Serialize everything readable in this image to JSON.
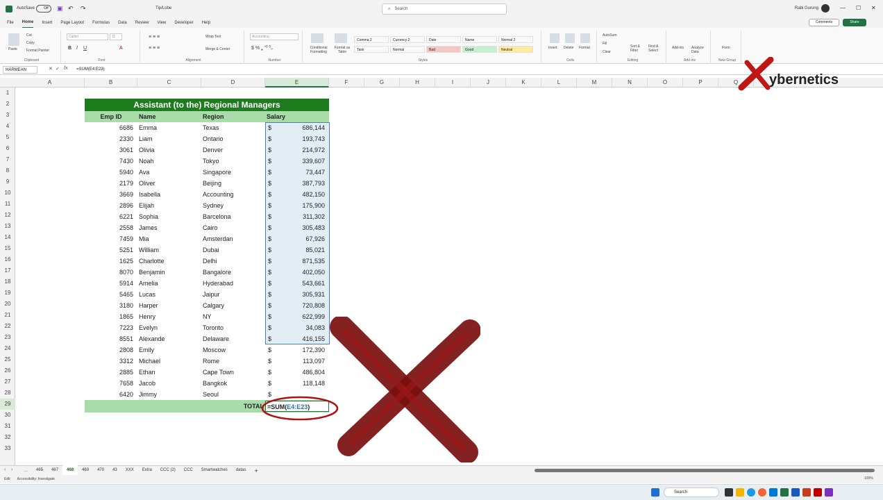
{
  "titlebar": {
    "autosave": "AutoSave",
    "toggle": "Off",
    "filename": "Tip/Lobe",
    "search": "Search",
    "user": "Rabi Gurung"
  },
  "menu": [
    "File",
    "Home",
    "Insert",
    "Page Layout",
    "Formulas",
    "Data",
    "Review",
    "View",
    "Developer",
    "Help"
  ],
  "menu_right": {
    "comments": "Comments",
    "share": "Share"
  },
  "ribbon": {
    "clipboard": {
      "paste": "Paste",
      "cut": "Cut",
      "copy": "Copy",
      "format_painter": "Format Painter",
      "label": "Clipboard"
    },
    "font": {
      "name": "Calibri",
      "size": "11",
      "label": "Font"
    },
    "alignment": {
      "wrap": "Wrap Text",
      "merge": "Merge & Center",
      "label": "Alignment"
    },
    "number": {
      "format": "Accounting",
      "label": "Number"
    },
    "styles": {
      "cond": "Conditional Formatting",
      "table": "Format as Table",
      "boxes": [
        "Comma 2",
        "Currency 2",
        "Date",
        "Name",
        "Normal 2",
        "Task",
        "Normal",
        "Bad",
        "Good",
        "Neutral"
      ],
      "label": "Styles"
    },
    "cells": {
      "insert": "Insert",
      "delete": "Delete",
      "format": "Format",
      "label": "Cells"
    },
    "editing": {
      "autosum": "AutoSum",
      "fill": "Fill",
      "clear": "Clear",
      "sort": "Sort & Filter",
      "find": "Find & Select",
      "label": "Editing"
    },
    "addins": {
      "addins": "Add-ins",
      "analyze": "Analyze Data",
      "label": "Add-ins"
    },
    "newgroup": {
      "form": "Form",
      "label": "New Group"
    }
  },
  "formula_bar": {
    "name_box": "HARMEAN",
    "formula": "=SUM(E4:E23)"
  },
  "columns": [
    "A",
    "B",
    "C",
    "D",
    "E",
    "F",
    "G",
    "H",
    "I",
    "J",
    "K",
    "L",
    "M",
    "N",
    "O",
    "P",
    "Q"
  ],
  "rows": [
    "1",
    "2",
    "3",
    "4",
    "5",
    "6",
    "7",
    "8",
    "9",
    "10",
    "11",
    "12",
    "13",
    "14",
    "15",
    "16",
    "17",
    "18",
    "19",
    "20",
    "21",
    "22",
    "23",
    "24",
    "25",
    "26",
    "27",
    "28",
    "29",
    "30",
    "31",
    "32",
    "33"
  ],
  "table": {
    "title": "Assistant (to the) Regional Managers",
    "headers": [
      "Emp ID",
      "Name",
      "Region",
      "Salary"
    ],
    "rows": [
      [
        "6686",
        "Emma",
        "Texas",
        "686,144"
      ],
      [
        "2330",
        "Liam",
        "Ontario",
        "193,743"
      ],
      [
        "3061",
        "Olivia",
        "Denver",
        "214,972"
      ],
      [
        "7430",
        "Noah",
        "Tokyo",
        "339,607"
      ],
      [
        "5940",
        "Ava",
        "Singapore",
        "73,447"
      ],
      [
        "2179",
        "Oliver",
        "Beijing",
        "387,793"
      ],
      [
        "3669",
        "Isabella",
        "Accounting",
        "482,150"
      ],
      [
        "2896",
        "Elijah",
        "Sydney",
        "175,900"
      ],
      [
        "6221",
        "Sophia",
        "Barcelona",
        "311,302"
      ],
      [
        "2558",
        "James",
        "Cairo",
        "305,483"
      ],
      [
        "7459",
        "Mia",
        "Amsterdan",
        "67,926"
      ],
      [
        "5251",
        "William",
        "Dubai",
        "85,021"
      ],
      [
        "1625",
        "Charlotte",
        "Delhi",
        "871,535"
      ],
      [
        "8070",
        "Benjamin",
        "Bangalore",
        "402,050"
      ],
      [
        "5914",
        "Amelia",
        "Hyderabad",
        "543,661"
      ],
      [
        "5465",
        "Lucas",
        "Jaipur",
        "305,931"
      ],
      [
        "3180",
        "Harper",
        "Calgary",
        "720,808"
      ],
      [
        "1865",
        "Henry",
        "NY",
        "622,999"
      ],
      [
        "7223",
        "Evelyn",
        "Toronto",
        "34,083"
      ],
      [
        "8551",
        "Alexande",
        "Delaware",
        "416,155"
      ],
      [
        "2808",
        "Emily",
        "Moscow",
        "172,390"
      ],
      [
        "3312",
        "Michael",
        "Rome",
        "113,097"
      ],
      [
        "2885",
        "Ethan",
        "Cape Town",
        "486,804"
      ],
      [
        "7658",
        "Jacob",
        "Bangkok",
        "118,148"
      ],
      [
        "6420",
        "Jimmy",
        "Seoul",
        ""
      ]
    ],
    "currency": "$",
    "total_label": "TOTAL",
    "total_formula_prefix": "=SUM(",
    "total_formula_range": "E4:E23",
    "total_formula_suffix": ")"
  },
  "logo": {
    "text": "ybernetics"
  },
  "sheet_tabs": [
    "465",
    "467",
    "468",
    "469",
    "470",
    "43",
    "XXX",
    "Extra",
    "CCC (2)",
    "CCC",
    "Smartwatches",
    "datas"
  ],
  "active_tab": "468",
  "status": {
    "mode": "Edit",
    "accessibility": "Accessibility: Investigate",
    "zoom": "100%"
  },
  "taskbar": {
    "search": "Search"
  },
  "colors": {
    "header_green": "#1e7b1e",
    "light_green": "#a8dca8",
    "accent": "#217346",
    "x_mark": "#7a1010"
  }
}
